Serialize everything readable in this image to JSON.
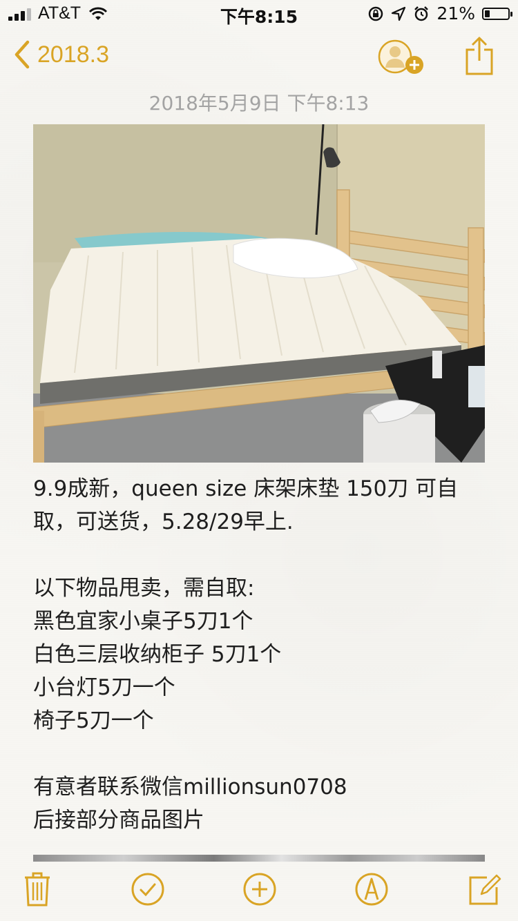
{
  "status_bar": {
    "carrier": "AT&T",
    "time": "下午8:15",
    "battery_percent": "21%",
    "battery_level": 0.21
  },
  "nav": {
    "back_label": "2018.3",
    "icons": [
      "chevron-left-icon",
      "add-person-icon",
      "share-icon"
    ],
    "accent_color": "#d9a425"
  },
  "note": {
    "date": "2018年5月9日 下午8:13",
    "lines": [
      "9.9成新，queen size 床架床垫 150刀 可自",
      "取，可送货，5.28/29早上.",
      "",
      "以下物品甩卖，需自取:",
      "黑色宜家小桌子5刀1个",
      "白色三层收纳柜子 5刀1个",
      "小台灯5刀一个",
      "椅子5刀一个",
      "",
      "有意者联系微信millionsun0708",
      "后接部分商品图片"
    ]
  },
  "toolbar": {
    "icons": [
      "trash-icon",
      "checklist-icon",
      "add-icon",
      "sketch-icon",
      "compose-icon"
    ]
  }
}
